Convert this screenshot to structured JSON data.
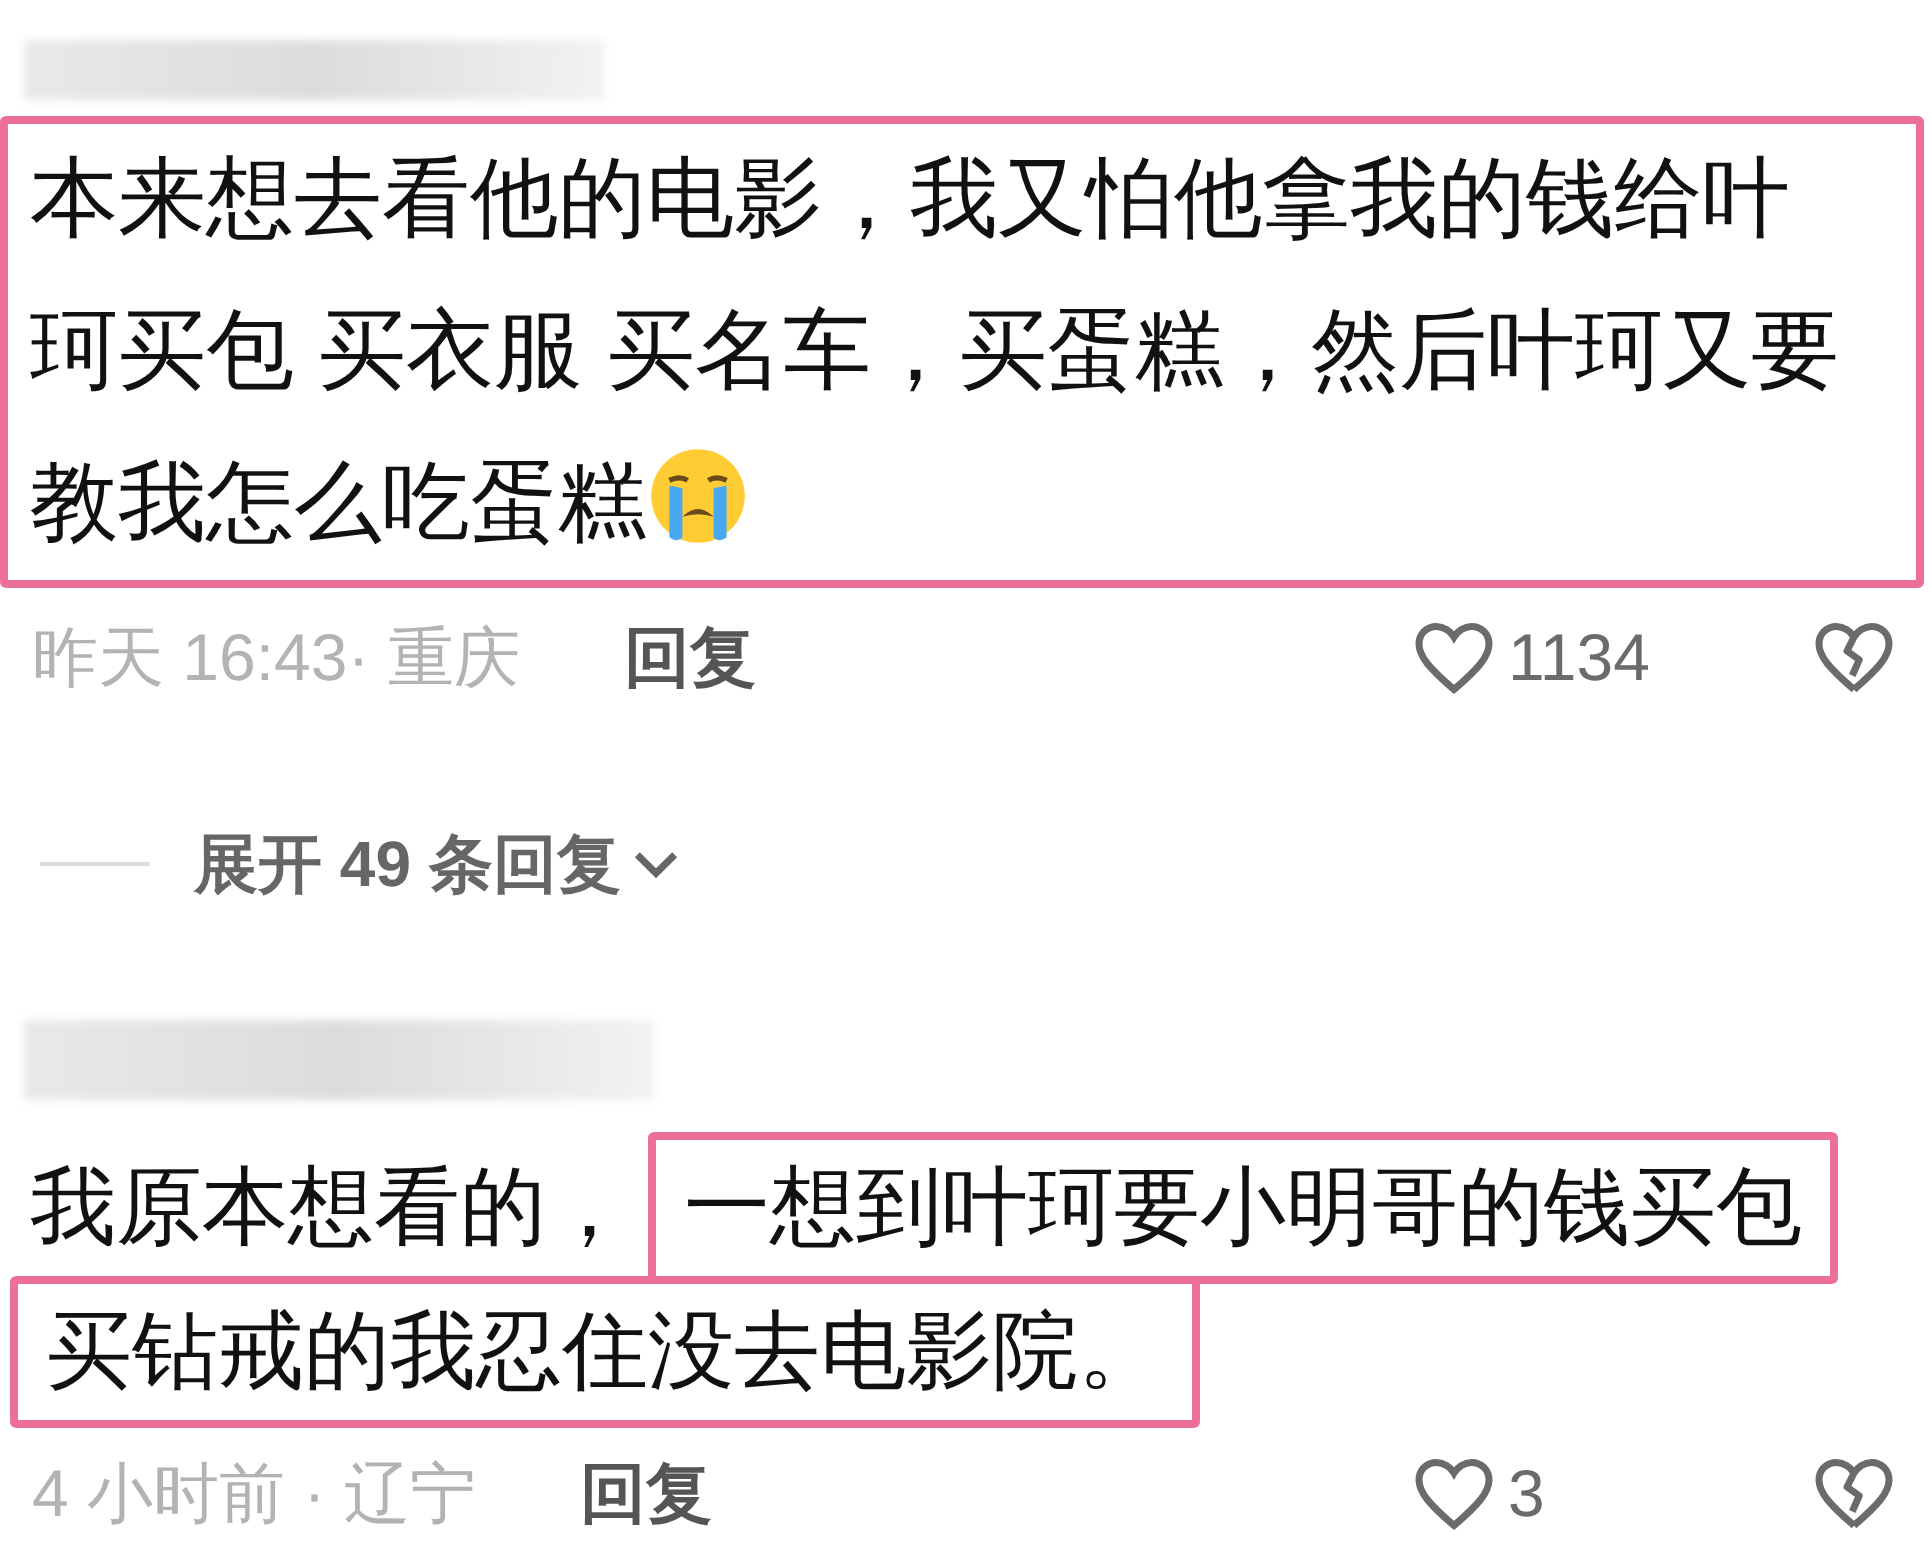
{
  "comments": [
    {
      "highlighted": true,
      "emoji": true,
      "lines": [
        [
          {
            "text": "本来想去看他的电影，我又怕他拿我的钱给叶"
          }
        ],
        [
          {
            "text": "珂买包 买衣服 买名车，买蛋糕，然后叶珂又要"
          }
        ],
        [
          {
            "text": "教我怎么吃蛋糕"
          }
        ]
      ],
      "time_location": "昨天 16:43· 重庆",
      "reply_label": "回复",
      "likes": "1134",
      "replies_toggle": "展开 49 条回复"
    },
    {
      "highlighted": false,
      "lines": [
        [
          {
            "text": "我原本想看的，",
            "highlighted": false
          },
          {
            "text": "一想到叶珂要小明哥的钱买包",
            "highlighted": true
          }
        ],
        [
          {
            "text": "买钻戒的我忍住没去电影院。",
            "highlighted": true
          }
        ]
      ],
      "time_location": "4 小时前 · 辽宁",
      "reply_label": "回复",
      "likes": "3"
    }
  ]
}
